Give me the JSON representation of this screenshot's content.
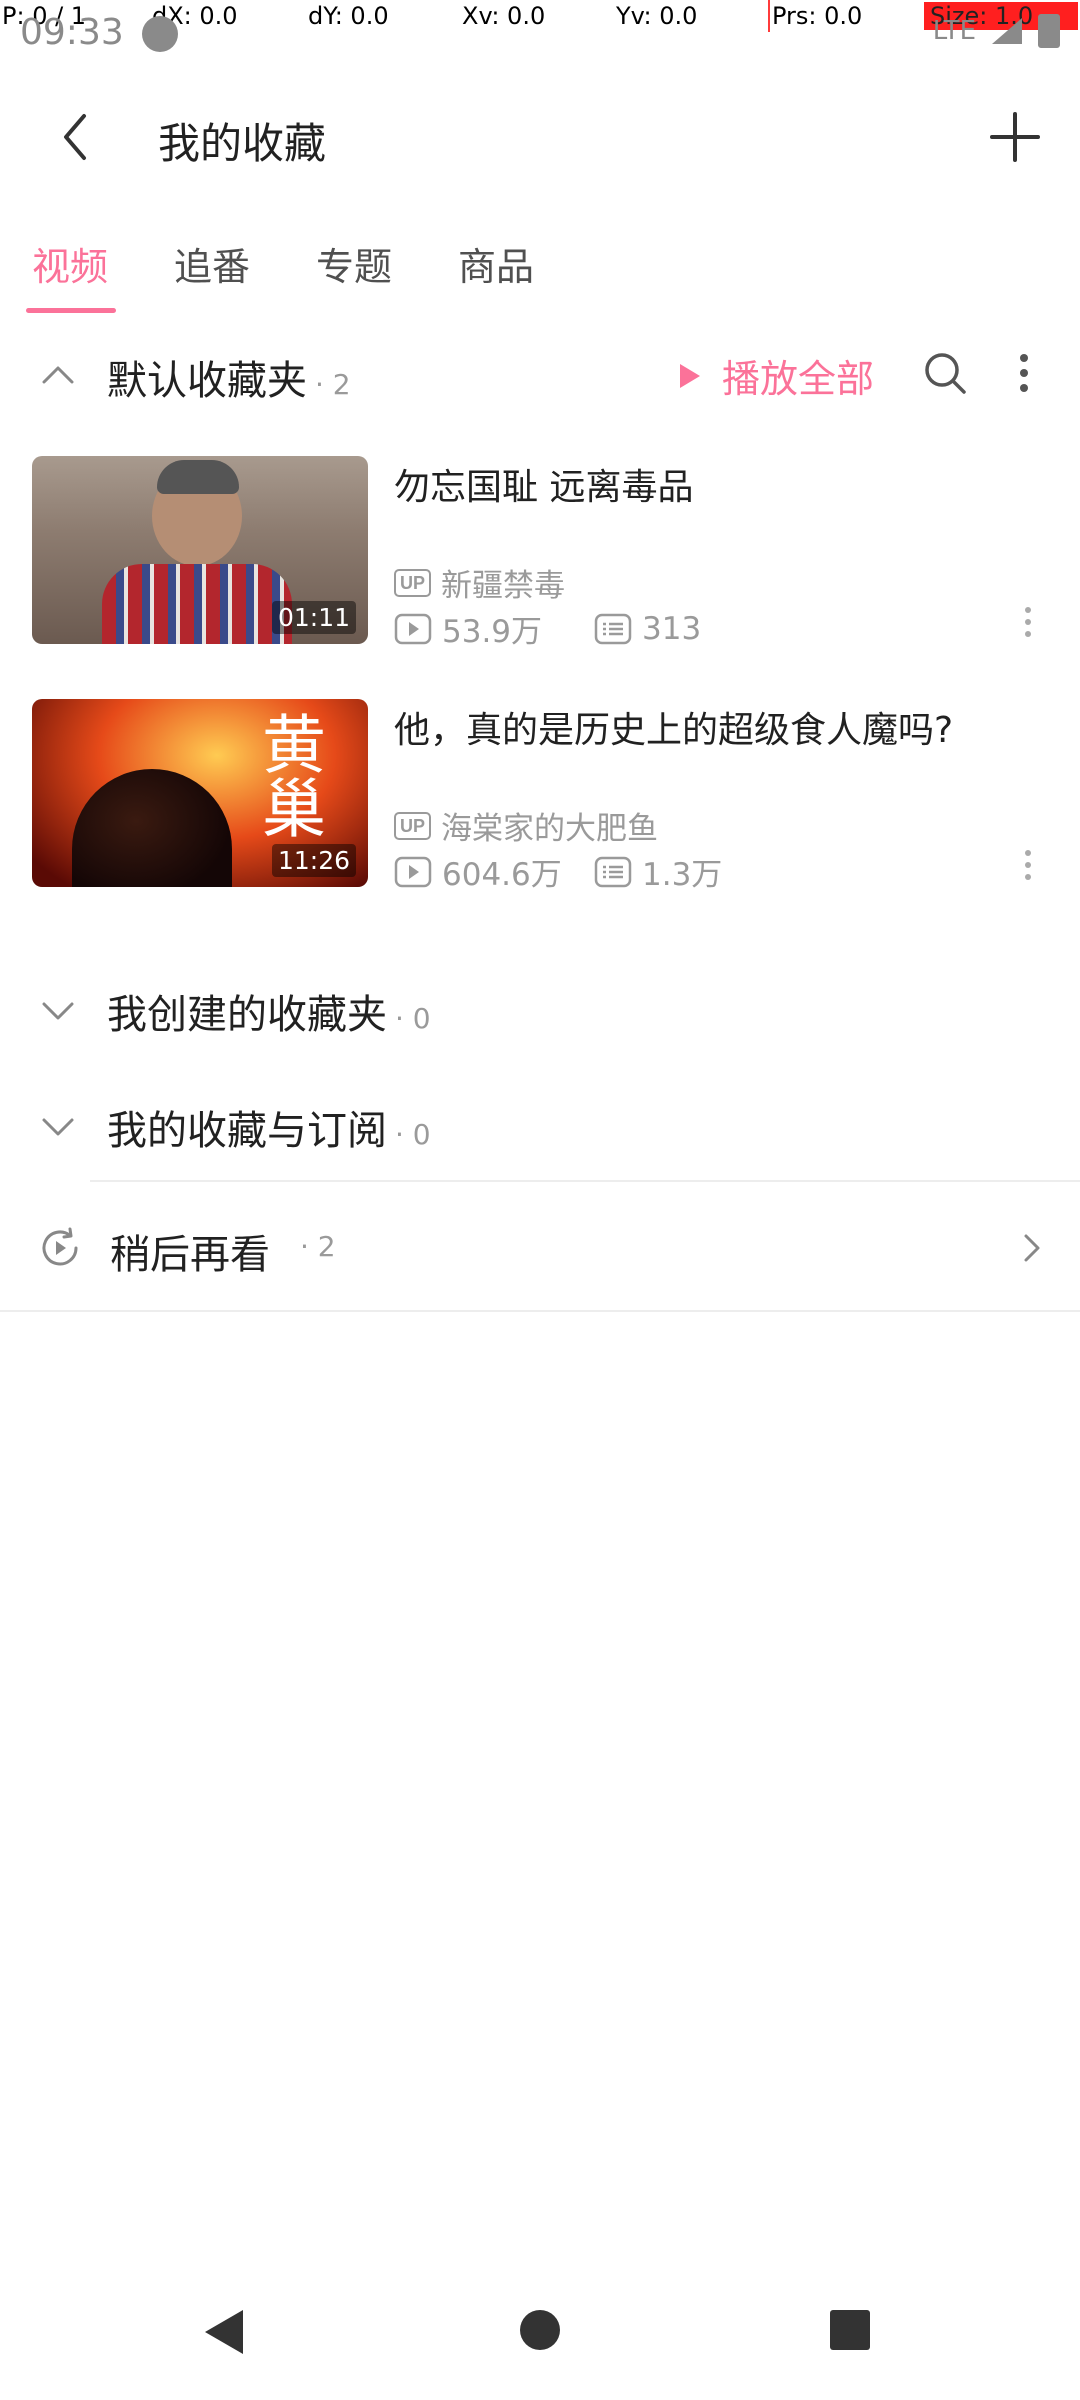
{
  "debug": {
    "p": "P: 0 / 1",
    "dx": "dX: 0.0",
    "dy": "dY: 0.0",
    "xv": "Xv: 0.0",
    "yv": "Yv: 0.0",
    "prs": "Prs: 0.0",
    "size": "Size: 1.0"
  },
  "status_bar": {
    "time": "09:33",
    "network": "LTE"
  },
  "header": {
    "title": "我的收藏"
  },
  "tabs": [
    {
      "label": "视频",
      "active": true
    },
    {
      "label": "追番",
      "active": false
    },
    {
      "label": "专题",
      "active": false
    },
    {
      "label": "商品",
      "active": false
    }
  ],
  "default_folder": {
    "name": "默认收藏夹",
    "count": "· 2",
    "play_all_label": "播放全部"
  },
  "videos": [
    {
      "title": "勿忘国耻 远离毒品",
      "duration": "01:11",
      "uploader": "新疆禁毒",
      "views": "53.9万",
      "danmaku": "313"
    },
    {
      "title": "他，真的是历史上的超级食人魔吗?",
      "duration": "11:26",
      "thumb_text": "黄巢",
      "uploader": "海棠家的大肥鱼",
      "views": "604.6万",
      "danmaku": "1.3万"
    }
  ],
  "up_badge": "UP",
  "created_folders": {
    "name": "我创建的收藏夹",
    "count": "· 0"
  },
  "subscribed_folders": {
    "name": "我的收藏与订阅",
    "count": "· 0"
  },
  "watch_later": {
    "label": "稍后再看",
    "count": "· 2"
  },
  "colors": {
    "accent": "#fb7299",
    "text": "#212121",
    "secondary": "#9a9a9a"
  }
}
